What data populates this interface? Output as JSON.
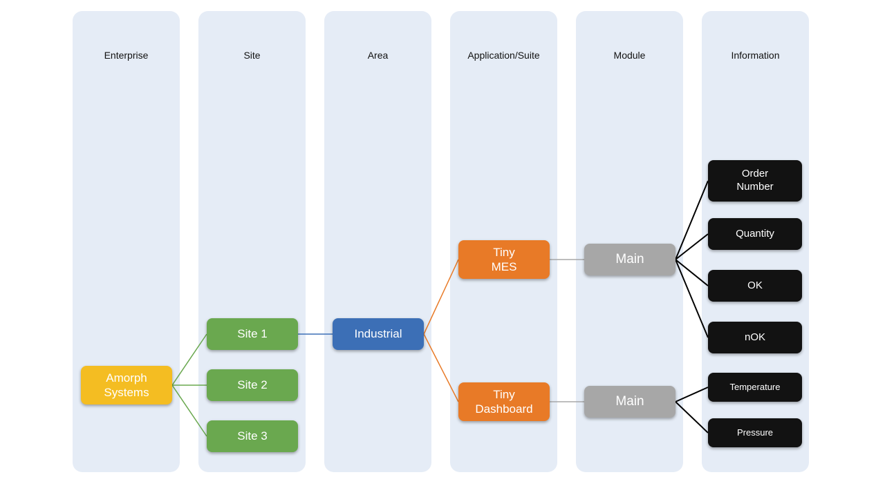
{
  "columns": {
    "enterprise": "Enterprise",
    "site": "Site",
    "area": "Area",
    "application": "Application/Suite",
    "module": "Module",
    "information": "Information"
  },
  "nodes": {
    "amorph": "Amorph\nSystems",
    "site1": "Site 1",
    "site2": "Site 2",
    "site3": "Site 3",
    "industrial": "Industrial",
    "tiny_mes": "Tiny\nMES",
    "tiny_dashboard": "Tiny\nDashboard",
    "main_mes": "Main",
    "main_dash": "Main",
    "order_number": "Order\nNumber",
    "quantity": "Quantity",
    "ok": "OK",
    "nok": "nOK",
    "temperature": "Temperature",
    "pressure": "Pressure"
  },
  "colors": {
    "column_bg": "#e5ecf6",
    "yellow": "#f4bd22",
    "green": "#6aa84f",
    "blue": "#3c6fb6",
    "orange": "#e87a27",
    "grey": "#a7a7a7",
    "black": "#121212"
  }
}
